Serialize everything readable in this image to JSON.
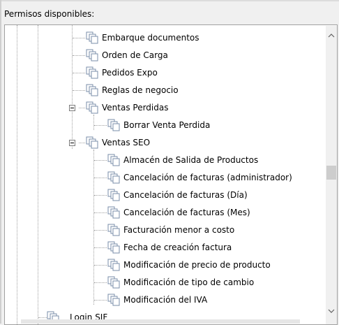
{
  "panel": {
    "title": "Permisos disponibles:"
  },
  "tree": {
    "items": [
      {
        "label": "Embarque documentos"
      },
      {
        "label": "Orden de Carga"
      },
      {
        "label": "Pedidos Expo"
      },
      {
        "label": "Reglas de negocio"
      },
      {
        "label": "Ventas Perdidas"
      },
      {
        "label": "Borrar Venta Perdida"
      },
      {
        "label": "Ventas SEO"
      },
      {
        "label": "Almacén de Salida de Productos"
      },
      {
        "label": "Cancelación de facturas (administrador)"
      },
      {
        "label": "Cancelación de facturas (Día)"
      },
      {
        "label": "Cancelación de facturas (Mes)"
      },
      {
        "label": "Facturación menor a costo"
      },
      {
        "label": "Fecha de creación factura"
      },
      {
        "label": "Modificación de precio de producto"
      },
      {
        "label": "Modificación de tipo de cambio"
      },
      {
        "label": "Modificación del IVA"
      },
      {
        "label": "Login SIF"
      }
    ]
  },
  "scrollbar": {
    "up_icon": "chevron-up-icon",
    "down_icon": "chevron-down-icon"
  },
  "colors": {
    "tree_lines": "#a0a0a0",
    "background": "#ffffff",
    "window": "#f0f0f0"
  }
}
